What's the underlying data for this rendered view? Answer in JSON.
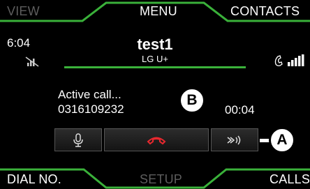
{
  "header": {
    "left_tab": "VIEW",
    "center_tab": "MENU",
    "right_tab": "CONTACTS"
  },
  "footer": {
    "left_tab": "DIAL NO.",
    "center_tab": "SETUP",
    "right_tab": "CALLS"
  },
  "status_bar": {
    "time": "6:04"
  },
  "call": {
    "contact_name": "test1",
    "carrier": "LG U+",
    "status": "Active call...",
    "number": "0316109232",
    "duration": "00:04"
  },
  "callouts": {
    "a": "A",
    "b": "B"
  },
  "icons": {
    "mic": "microphone-icon",
    "hangup": "hang-up-icon",
    "voice": "voice-control-icon",
    "no_signal": "no-signal-icon",
    "phone_signal": "phone-signal-icon"
  },
  "colors": {
    "accent": "#3ab13a",
    "hangup": "#e8282e",
    "background": "#000000"
  }
}
